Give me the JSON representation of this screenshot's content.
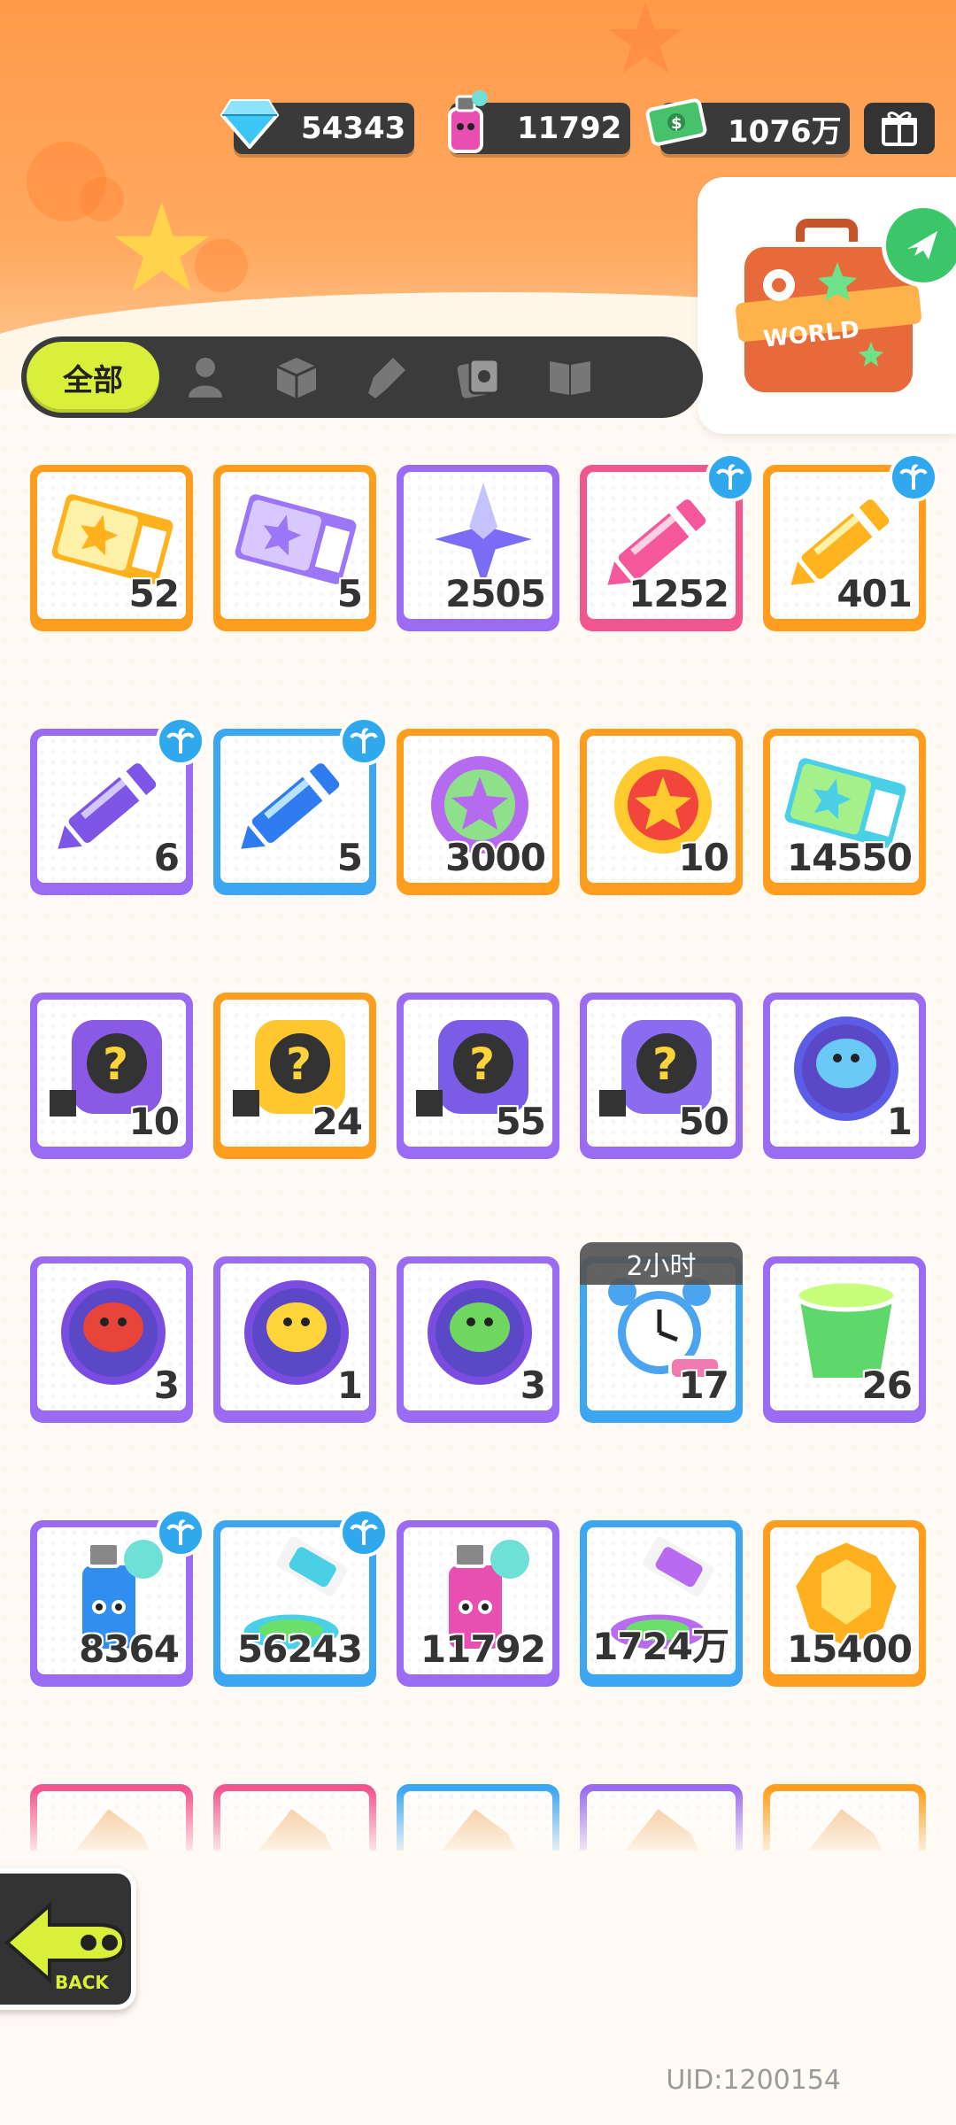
{
  "currencies": [
    {
      "name": "diamond",
      "value": "54343",
      "icon": "diamond-icon"
    },
    {
      "name": "spray",
      "value": "11792",
      "icon": "spray-can-icon"
    },
    {
      "name": "cash",
      "value": "1076万",
      "icon": "cash-icon"
    }
  ],
  "world_label": "WORLD",
  "tabs": {
    "all_label": "全部",
    "icons": [
      "person-icon",
      "box-icon",
      "brush-icon",
      "card-icon",
      "book-icon"
    ]
  },
  "items": [
    {
      "count": "52",
      "rarity": "orange",
      "icon": "gold-ticket-icon"
    },
    {
      "count": "5",
      "rarity": "orange",
      "icon": "purple-ticket-icon"
    },
    {
      "count": "2505",
      "rarity": "purple",
      "icon": "purple-star-icon"
    },
    {
      "count": "1252",
      "rarity": "pink",
      "icon": "pink-crayon-icon",
      "badge": true
    },
    {
      "count": "401",
      "rarity": "orange",
      "icon": "yellow-crayon-icon",
      "badge": true
    },
    {
      "count": "6",
      "rarity": "purple",
      "icon": "purple-crayon-icon",
      "badge": true
    },
    {
      "count": "5",
      "rarity": "blue",
      "icon": "blue-crayon-icon",
      "badge": true
    },
    {
      "count": "3000",
      "rarity": "orange",
      "icon": "cool-badge-icon"
    },
    {
      "count": "10",
      "rarity": "orange",
      "icon": "star-badge-icon"
    },
    {
      "count": "14550",
      "rarity": "orange",
      "icon": "season-ticket-icon"
    },
    {
      "count": "10",
      "rarity": "purple",
      "icon": "mystery-egg-icon"
    },
    {
      "count": "24",
      "rarity": "orange",
      "icon": "mystery-deity-gold-icon"
    },
    {
      "count": "55",
      "rarity": "purple",
      "icon": "mystery-deity-purple-icon"
    },
    {
      "count": "50",
      "rarity": "purple",
      "icon": "travel-card-icon"
    },
    {
      "count": "1",
      "rarity": "purple",
      "icon": "blue-fish-token-icon"
    },
    {
      "count": "3",
      "rarity": "purple",
      "icon": "red-fish-token-icon"
    },
    {
      "count": "1",
      "rarity": "purple",
      "icon": "yellow-squid-token-icon"
    },
    {
      "count": "3",
      "rarity": "purple",
      "icon": "sprout-token-icon"
    },
    {
      "count": "17",
      "rarity": "blue",
      "icon": "alarm-clock-icon",
      "timer": "2小时"
    },
    {
      "count": "26",
      "rarity": "purple",
      "icon": "green-jelly-cup-icon"
    },
    {
      "count": "8364",
      "rarity": "purple",
      "icon": "blue-spray-can-icon",
      "badge": true
    },
    {
      "count": "56243",
      "rarity": "blue",
      "icon": "paint-tube-icon",
      "badge": true
    },
    {
      "count": "11792",
      "rarity": "purple",
      "icon": "pink-spray-can-icon"
    },
    {
      "count": "1724万",
      "rarity": "blue",
      "icon": "rainbow-paint-tube-icon"
    },
    {
      "count": "15400",
      "rarity": "orange",
      "icon": "gold-gem-icon"
    },
    {
      "count": "",
      "rarity": "pink",
      "icon": "partial-item-icon"
    },
    {
      "count": "",
      "rarity": "pink",
      "icon": "partial-item-icon"
    },
    {
      "count": "",
      "rarity": "blue",
      "icon": "partial-item-icon"
    },
    {
      "count": "",
      "rarity": "purple",
      "icon": "partial-item-icon"
    },
    {
      "count": "",
      "rarity": "orange",
      "icon": "partial-item-icon"
    }
  ],
  "back_label": "BACK",
  "uid_text": "UID:1200154"
}
